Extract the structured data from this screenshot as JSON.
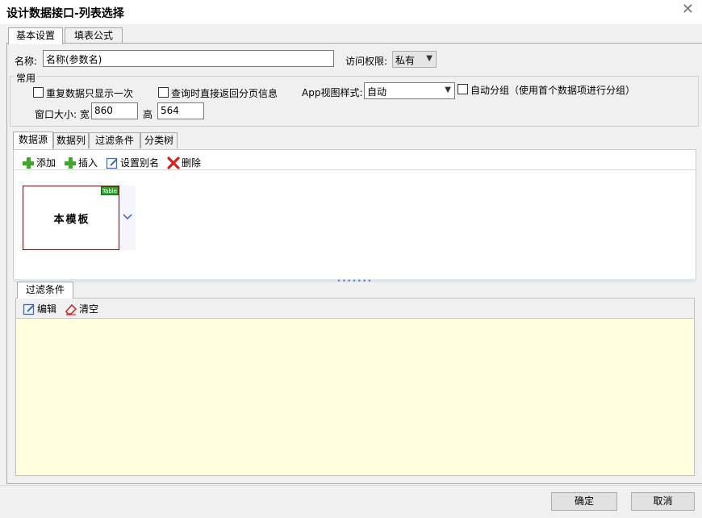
{
  "window": {
    "title": "设计数据接口-列表选择",
    "close_glyph": "✕"
  },
  "top_tabs": [
    "基本设置",
    "填表公式"
  ],
  "basic": {
    "name_label": "名称:",
    "name_value": "名称(参数名)",
    "access_label": "访问权限:",
    "access_value": "私有"
  },
  "common": {
    "group_title": "常用",
    "repeat_only_once": "重复数据只显示一次",
    "return_paging": "查询时直接返回分页信息",
    "app_view_label": "App视图样式:",
    "app_view_value": "自动",
    "auto_group": "自动分组（使用首个数据项进行分组）",
    "window_size_label": "窗口大小: 宽",
    "width_value": "860",
    "height_label": "高",
    "height_value": "564"
  },
  "data_tabs": [
    "数据源",
    "数据列",
    "过滤条件",
    "分类树"
  ],
  "toolbar": {
    "add": "添加",
    "insert": "插入",
    "alias": "设置别名",
    "delete": "删除"
  },
  "source_card": {
    "name": "本模板",
    "badge": "Table"
  },
  "filter": {
    "tab": "过滤条件",
    "edit": "编辑",
    "clear": "清空"
  },
  "buttons": {
    "ok": "确定",
    "cancel": "取消"
  },
  "colors": {
    "card_border": "#9b0000",
    "filter_bg": "#ffffde",
    "add_green": "#3ea82b",
    "delete_red": "#d42020"
  }
}
